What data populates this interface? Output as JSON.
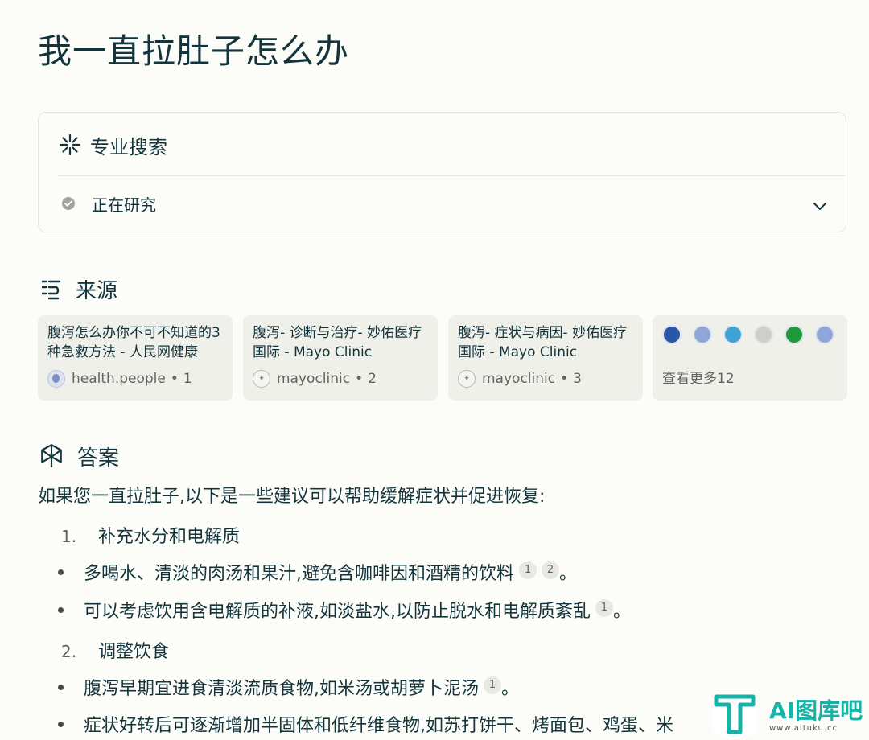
{
  "question": "我一直拉肚子怎么办",
  "pro_search": {
    "label": "专业搜索",
    "status": "正在研究"
  },
  "sources": {
    "heading": "来源",
    "items": [
      {
        "title": "腹泻怎么办你不可不知道的3种急救方法 - 人民网健康",
        "site": "health.people",
        "index": "1"
      },
      {
        "title": "腹泻- 诊断与治疗- 妙佑医疗国际 - Mayo Clinic",
        "site": "mayoclinic",
        "index": "2"
      },
      {
        "title": "腹泻- 症状与病因- 妙佑医疗国际 - Mayo Clinic",
        "site": "mayoclinic",
        "index": "3"
      }
    ],
    "more_label": "查看更多12",
    "more_icon_colors": [
      "#2a56a8",
      "#8fa6d9",
      "#3ea2d6",
      "#cfcfc8",
      "#1e9a3a",
      "#8fa6d9"
    ]
  },
  "answer": {
    "heading": "答案",
    "intro": "如果您一直拉肚子,以下是一些建议可以帮助缓解症状并促进恢复:",
    "steps": [
      {
        "num": "1.",
        "title": "补充水分和电解质"
      },
      {
        "num": "2.",
        "title": "调整饮食"
      }
    ],
    "bullets": [
      {
        "text": "多喝水、清淡的肉汤和果汁,避免含咖啡因和酒精的饮料",
        "cites": [
          "1",
          "2"
        ],
        "end": "。"
      },
      {
        "text": "可以考虑饮用含电解质的补液,如淡盐水,以防止脱水和电解质紊乱",
        "cites": [
          "1"
        ],
        "end": "。"
      },
      {
        "text": "腹泻早期宜进食清淡流质食物,如米汤或胡萝卜泥汤",
        "cites": [
          "1"
        ],
        "end": "。"
      },
      {
        "text": "症状好转后可逐渐增加半固体和低纤维食物,如苏打饼干、烤面包、鸡蛋、米",
        "cites": [],
        "end": ""
      }
    ]
  },
  "watermark": {
    "brand": "AI图库吧",
    "url": "www.aituku.cc"
  }
}
